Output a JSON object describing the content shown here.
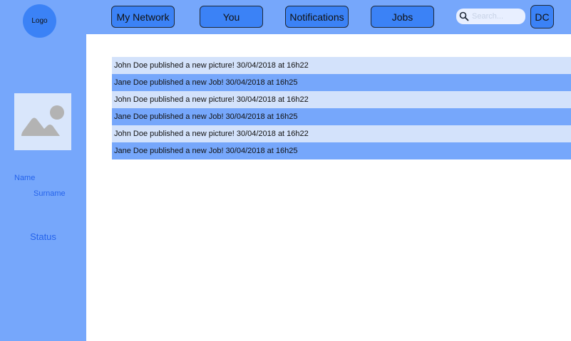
{
  "header": {
    "logo_label": "Logo",
    "nav": [
      {
        "label": "My Network"
      },
      {
        "label": "You"
      },
      {
        "label": "Notifications"
      },
      {
        "label": "Jobs"
      }
    ],
    "search": {
      "placeholder": "Search..."
    },
    "user_initials": "DC"
  },
  "sidebar": {
    "name": "Name",
    "surname": "Surname",
    "status": "Status"
  },
  "feed": {
    "items": [
      {
        "text": "John Doe published a new picture! 30/04/2018 at 16h22"
      },
      {
        "text": "Jane Doe published a new Job! 30/04/2018 at 16h25"
      },
      {
        "text": "John Doe published a new picture! 30/04/2018 at 16h22"
      },
      {
        "text": "Jane Doe published a new Job! 30/04/2018 at 16h25"
      },
      {
        "text": "John Doe published a new picture! 30/04/2018 at 16h22"
      },
      {
        "text": "Jane Doe published a new Job! 30/04/2018 at 16h25"
      }
    ]
  },
  "colors": {
    "bar_blue": "#76a7fb",
    "button_blue": "#3b82f6",
    "row_light": "#d3e2fb",
    "text_link_blue": "#2563eb"
  }
}
